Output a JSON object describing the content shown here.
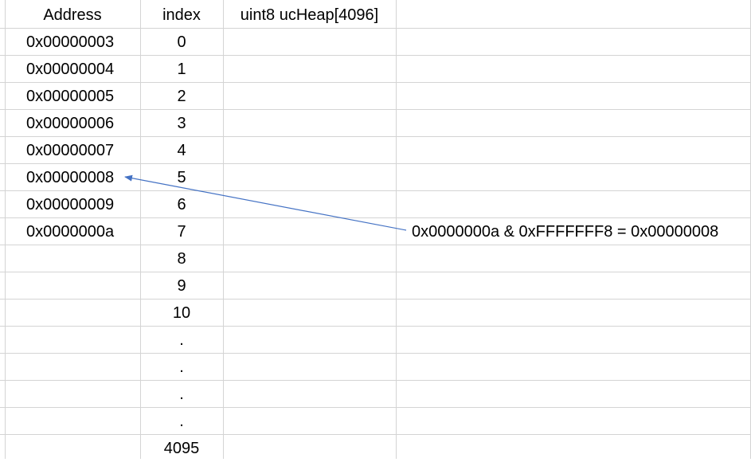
{
  "headers": {
    "address": "Address",
    "index": "index",
    "heap": "uint8 ucHeap[4096]"
  },
  "rows": [
    {
      "address": "0x00000003",
      "index": "0"
    },
    {
      "address": "0x00000004",
      "index": "1"
    },
    {
      "address": "0x00000005",
      "index": "2"
    },
    {
      "address": "0x00000006",
      "index": "3"
    },
    {
      "address": "0x00000007",
      "index": "4"
    },
    {
      "address": "0x00000008",
      "index": "5"
    },
    {
      "address": "0x00000009",
      "index": "6"
    },
    {
      "address": "0x0000000a",
      "index": "7"
    },
    {
      "address": "",
      "index": "8"
    },
    {
      "address": "",
      "index": "9"
    },
    {
      "address": "",
      "index": "10"
    },
    {
      "address": "",
      "index": "."
    },
    {
      "address": "",
      "index": "."
    },
    {
      "address": "",
      "index": "."
    },
    {
      "address": "",
      "index": "."
    },
    {
      "address": "",
      "index": "4095"
    }
  ],
  "annotation": {
    "text": "0x0000000a & 0xFFFFFFF8 = 0x00000008",
    "arrow_target_row_index": 5,
    "arrow_source_row_index": 7
  },
  "colors": {
    "gridline": "#d4d4d4",
    "arrow": "#4472c4",
    "text": "#000000"
  }
}
